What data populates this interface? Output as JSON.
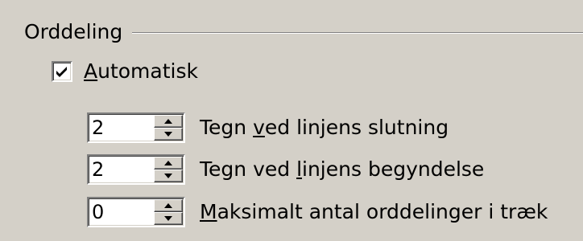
{
  "group": {
    "title": "Orddeling"
  },
  "automatic": {
    "checked": true,
    "label_mnemonic": "A",
    "label_rest": "utomatisk"
  },
  "spinners": [
    {
      "value": "2",
      "label_before": "Tegn ",
      "label_mnemonic": "v",
      "label_after": "ed linjens slutning"
    },
    {
      "value": "2",
      "label_before": "Tegn ved ",
      "label_mnemonic": "l",
      "label_after": "injens begyndelse"
    },
    {
      "value": "0",
      "label_before": "",
      "label_mnemonic": "M",
      "label_after": "aksimalt antal orddelinger i træk"
    }
  ],
  "icons": {
    "checkmark": "checkmark-icon",
    "spin_up": "triangle-up-icon",
    "spin_down": "triangle-down-icon"
  }
}
